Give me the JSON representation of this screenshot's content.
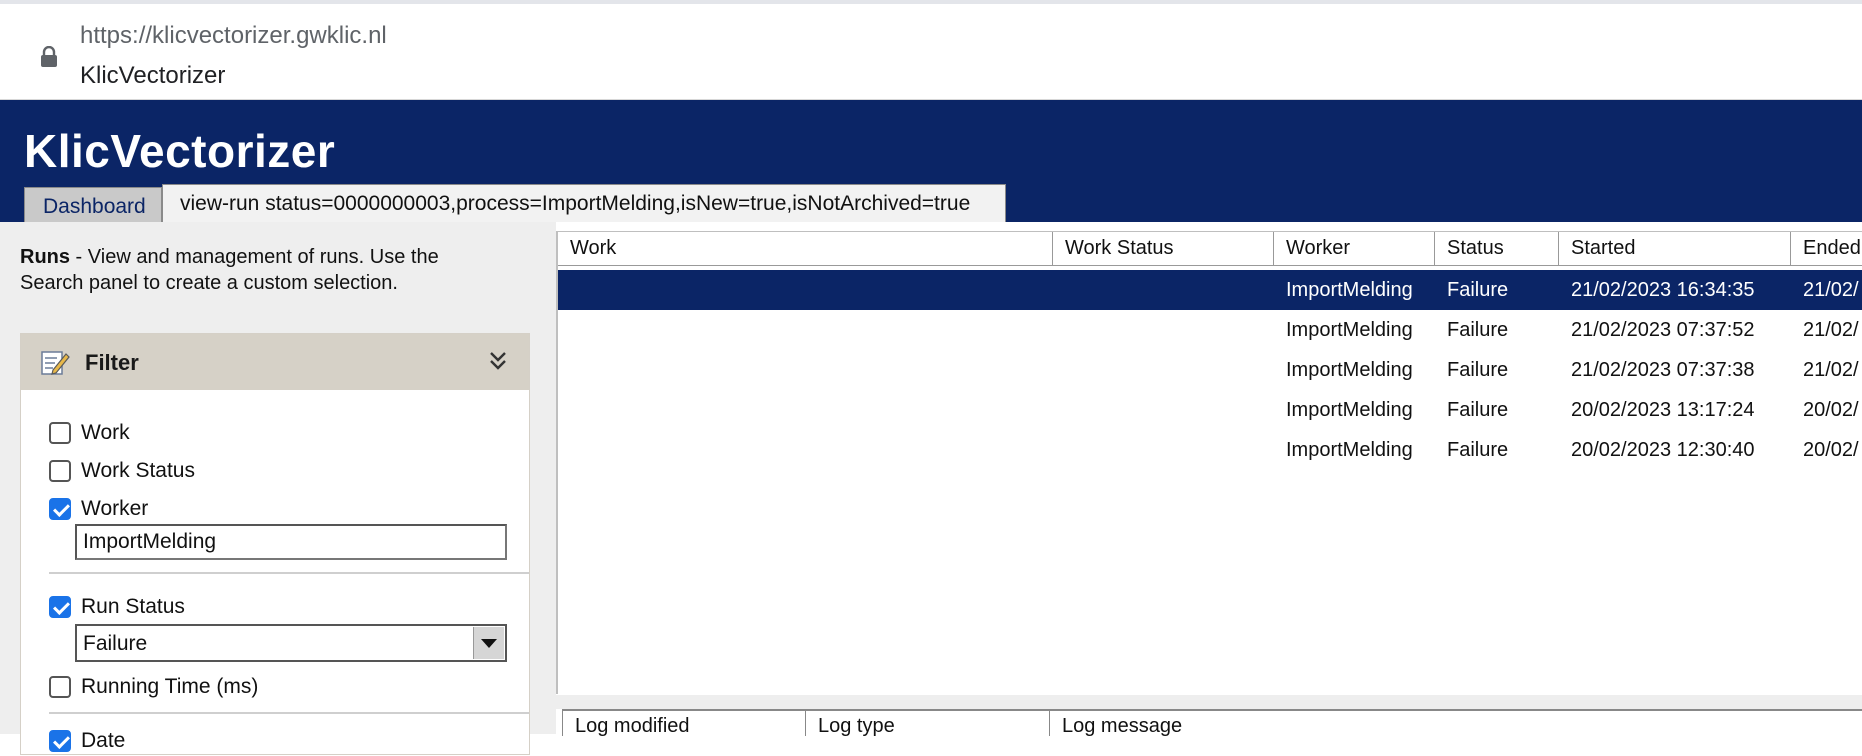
{
  "browser": {
    "url": "https://klicvectorizer.gwklic.nl",
    "tab_title": "KlicVectorizer"
  },
  "app": {
    "title": "KlicVectorizer",
    "tabs": {
      "dashboard": "Dashboard",
      "view": "view-run status=0000000003,process=ImportMelding,isNew=true,isNotArchived=true"
    }
  },
  "left_panel": {
    "description_bold": "Runs",
    "description_text": " - View and management of runs. Use the Search panel to create a custom selection.",
    "filter": {
      "title": "Filter",
      "items": {
        "work": {
          "label": "Work",
          "checked": false
        },
        "work_status": {
          "label": "Work Status",
          "checked": false
        },
        "worker": {
          "label": "Worker",
          "checked": true,
          "value": "ImportMelding"
        },
        "run_status": {
          "label": "Run Status",
          "checked": true,
          "value": "Failure"
        },
        "running_time": {
          "label": "Running Time (ms)",
          "checked": false
        },
        "date": {
          "label": "Date",
          "checked": true
        }
      }
    }
  },
  "runs_table": {
    "columns": [
      "Work",
      "Work Status",
      "Worker",
      "Status",
      "Started",
      "Ended"
    ],
    "rows": [
      {
        "work": "",
        "work_status": "",
        "worker": "ImportMelding",
        "status": "Failure",
        "started": "21/02/2023 16:34:35",
        "ended": "21/02/",
        "selected": true
      },
      {
        "work": "",
        "work_status": "",
        "worker": "ImportMelding",
        "status": "Failure",
        "started": "21/02/2023 07:37:52",
        "ended": "21/02/",
        "selected": false
      },
      {
        "work": "",
        "work_status": "",
        "worker": "ImportMelding",
        "status": "Failure",
        "started": "21/02/2023 07:37:38",
        "ended": "21/02/",
        "selected": false
      },
      {
        "work": "",
        "work_status": "",
        "worker": "ImportMelding",
        "status": "Failure",
        "started": "20/02/2023 13:17:24",
        "ended": "20/02/",
        "selected": false
      },
      {
        "work": "",
        "work_status": "",
        "worker": "ImportMelding",
        "status": "Failure",
        "started": "20/02/2023 12:30:40",
        "ended": "20/02/",
        "selected": false
      }
    ]
  },
  "log_table": {
    "columns": [
      "Log modified",
      "Log type",
      "Log message"
    ]
  },
  "colors": {
    "header_bg": "#0b2566",
    "selected_row_bg": "#0b2566",
    "checkbox_checked": "#1a73e8",
    "filter_header_bg": "#d6d1c7",
    "panel_bg": "#eeeeee"
  },
  "icons": {
    "lock": "lock-icon",
    "filter": "filter-edit-icon",
    "collapse": "double-chevron-down-icon",
    "dropdown": "triangle-down-icon"
  }
}
